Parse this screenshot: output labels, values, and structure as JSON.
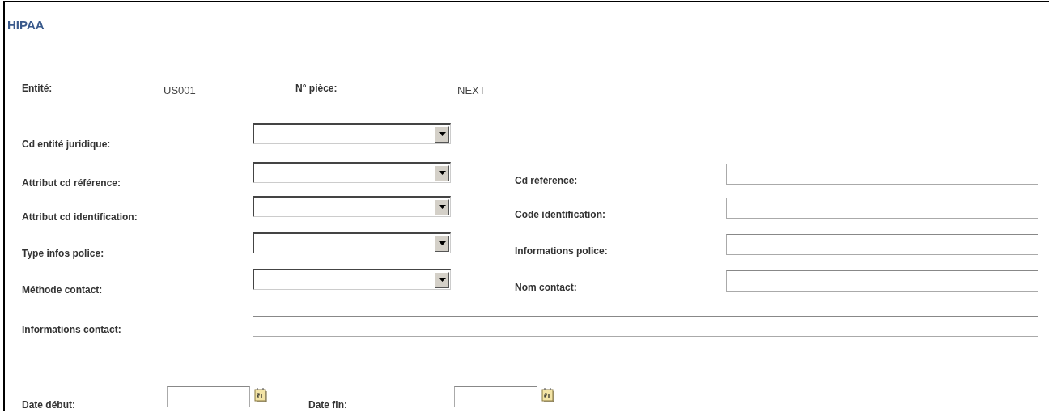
{
  "title": "HIPAA",
  "header": [
    {
      "label": "Entité:",
      "value": "US001"
    },
    {
      "label": "N° pièce:",
      "value": "NEXT"
    }
  ],
  "rows": [
    {
      "left": {
        "label": "Cd entité juridique:"
      }
    },
    {
      "left": {
        "label": "Attribut cd référence:"
      },
      "right": {
        "label": "Cd référence:"
      }
    },
    {
      "left": {
        "label": "Attribut cd identification:"
      },
      "right": {
        "label": "Code identification:"
      }
    },
    {
      "left": {
        "label": "Type infos police:"
      },
      "right": {
        "label": "Informations police:"
      }
    },
    {
      "left": {
        "label": "Méthode contact:"
      },
      "right": {
        "label": "Nom contact:"
      }
    }
  ],
  "contact_info": {
    "label": "Informations contact:"
  },
  "dates": [
    {
      "label": "Date début:"
    },
    {
      "label": "Date fin:"
    }
  ]
}
